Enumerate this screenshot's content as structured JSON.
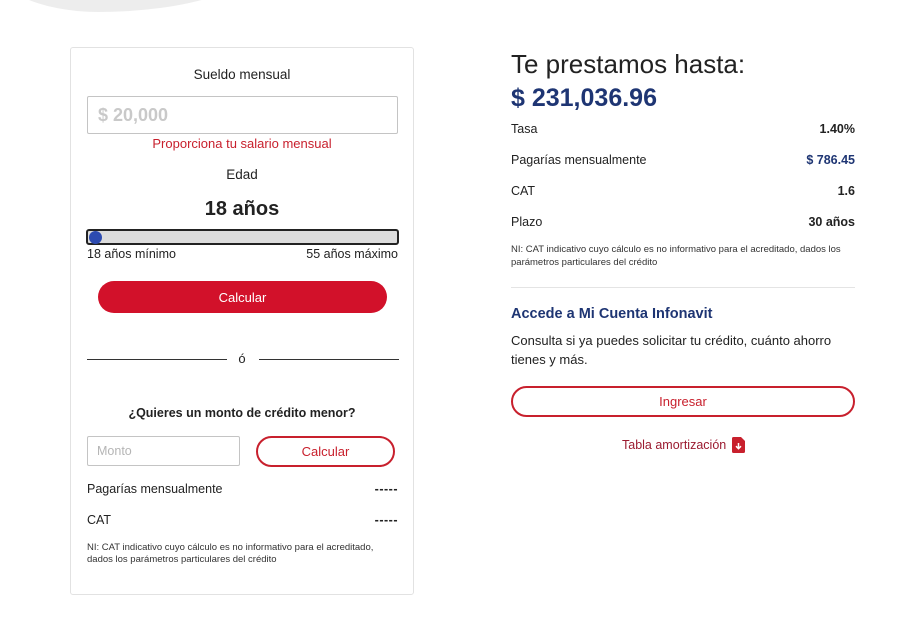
{
  "colors": {
    "accent_red": "#d2112a",
    "navy": "#1e3573",
    "slider_thumb": "#2d4bb0"
  },
  "calculator": {
    "salary_label": "Sueldo mensual",
    "salary_placeholder": "$ 20,000",
    "salary_error": "Proporciona tu salario mensual",
    "age_label": "Edad",
    "age_value": "18 años",
    "age_slider_level": 0,
    "age_min": "18 años mínimo",
    "age_max": "55 años máximo",
    "calculate_button": "Calcular",
    "or_text": "ó",
    "smaller_question": "¿Quieres un monto de crédito menor?",
    "amount_placeholder": "Monto",
    "calculate_button_secondary": "Calcular",
    "monthly_label": "Pagarías mensualmente",
    "monthly_value": "-----",
    "cat_label": "CAT",
    "cat_value": "-----",
    "note": "NI: CAT indicativo cuyo cálculo es no informativo para el acreditado, dados los parámetros particulares del crédito"
  },
  "result": {
    "title": "Te prestamos hasta:",
    "amount": "$ 231,036.96",
    "rows": [
      {
        "label": "Tasa",
        "value": "1.40%"
      },
      {
        "label": "Pagarías mensualmente",
        "value": "$ 786.45"
      },
      {
        "label": "CAT",
        "value": "1.6"
      },
      {
        "label": "Plazo",
        "value": "30 años"
      }
    ],
    "note": "NI: CAT indicativo cuyo cálculo es no informativo para el acreditado, dados los parámetros particulares del crédito"
  },
  "account": {
    "title": "Accede a Mi Cuenta Infonavit",
    "text": "Consulta si ya puedes solicitar tu crédito, cuánto ahorro tienes y más.",
    "login_button": "Ingresar",
    "amortization_link": "Tabla amortización",
    "amortization_icon": "file-download-icon"
  }
}
